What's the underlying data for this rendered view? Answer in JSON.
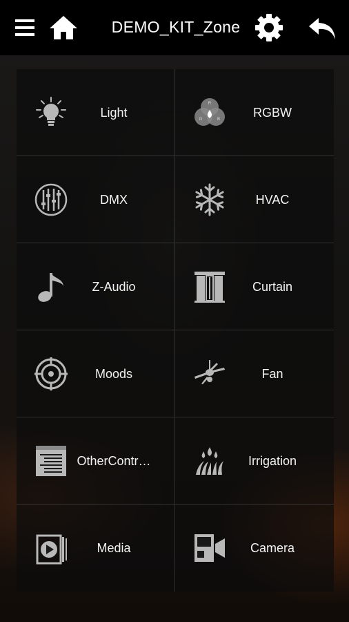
{
  "header": {
    "title": "DEMO_KIT_Zone",
    "menu_icon": "hamburger-menu-icon",
    "home_icon": "home-icon",
    "settings_icon": "gear-icon",
    "back_icon": "back-arrow-icon"
  },
  "tiles": [
    {
      "label": "Light",
      "icon": "light-bulb-icon"
    },
    {
      "label": "RGBW",
      "icon": "rgbw-icon"
    },
    {
      "label": "DMX",
      "icon": "dmx-sliders-icon"
    },
    {
      "label": "HVAC",
      "icon": "snowflake-icon"
    },
    {
      "label": "Z-Audio",
      "icon": "music-note-icon"
    },
    {
      "label": "Curtain",
      "icon": "curtain-icon"
    },
    {
      "label": "Moods",
      "icon": "target-icon"
    },
    {
      "label": "Fan",
      "icon": "ceiling-fan-icon"
    },
    {
      "label": "OtherContr…",
      "icon": "list-panel-icon"
    },
    {
      "label": "Irrigation",
      "icon": "irrigation-icon"
    },
    {
      "label": "Media",
      "icon": "media-play-icon"
    },
    {
      "label": "Camera",
      "icon": "camera-icon"
    }
  ],
  "rgbw_letters": {
    "r": "R",
    "g": "G",
    "b": "B"
  },
  "colors": {
    "topbar": "#000000",
    "text": "#ffffff",
    "icon": "#b8b8b8"
  }
}
